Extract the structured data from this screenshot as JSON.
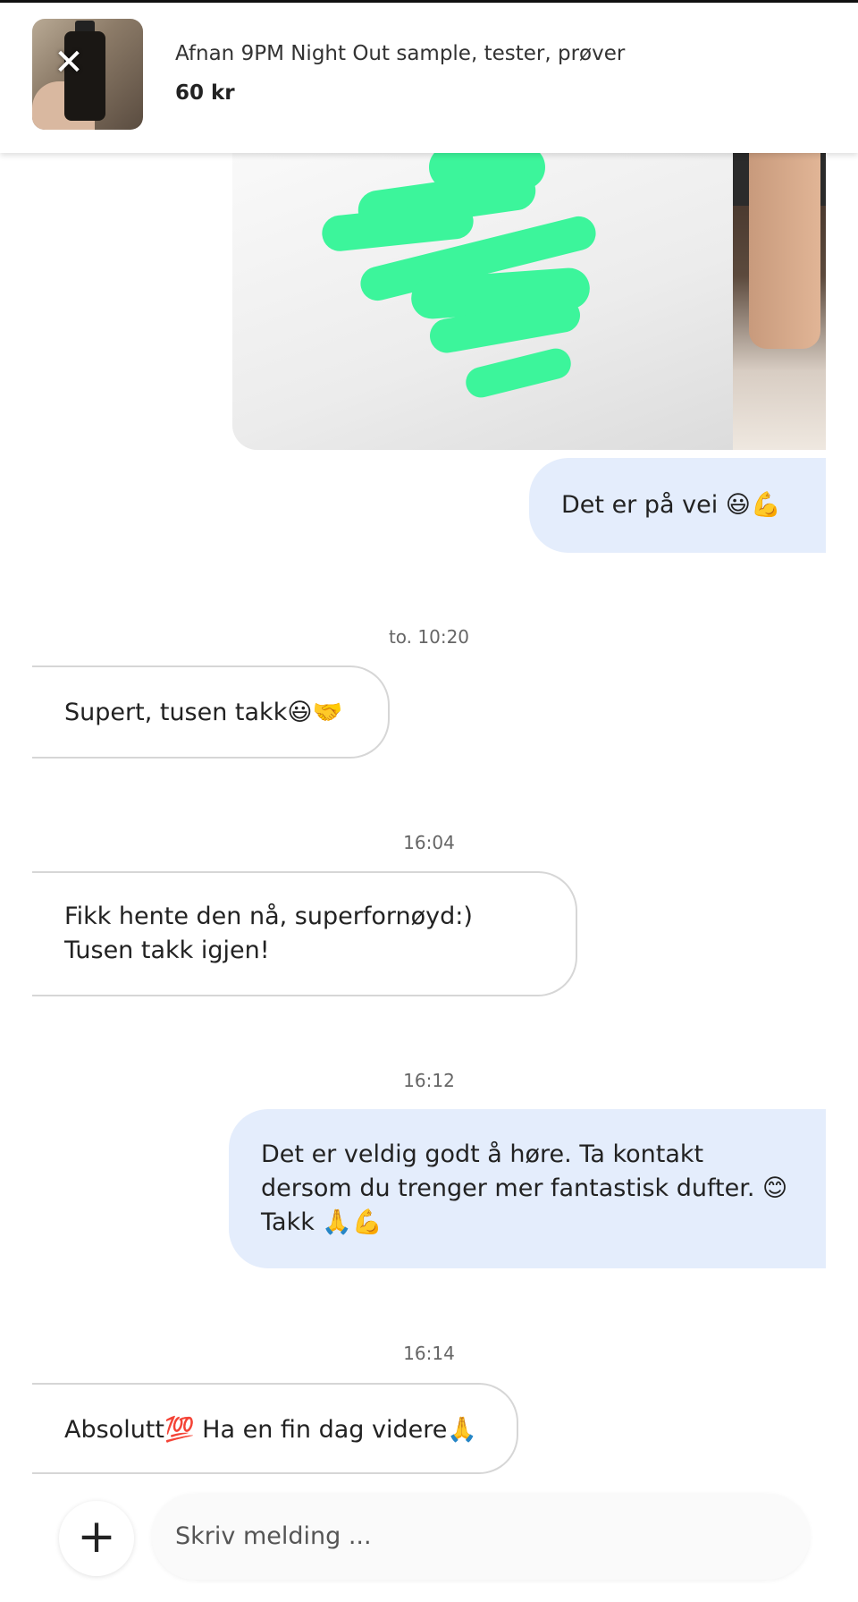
{
  "listing": {
    "title": "Afnan 9PM Night Out sample, tester, prøver",
    "price": "60 kr",
    "close_glyph": "✕"
  },
  "messages": [
    {
      "direction": "out",
      "text": "Det er på vei 😃💪"
    },
    {
      "timestamp": "to. 10:20"
    },
    {
      "direction": "in",
      "text": "Supert, tusen takk😃🤝"
    },
    {
      "timestamp": "16:04"
    },
    {
      "direction": "in",
      "text": "Fikk hente den nå, superfornøyd:) Tusen takk igjen!"
    },
    {
      "timestamp": "16:12"
    },
    {
      "direction": "out",
      "text": "Det er veldig godt å høre. Ta kontakt dersom du trenger mer fantastisk dufter. 😊 Takk 🙏💪"
    },
    {
      "timestamp": "16:14"
    },
    {
      "direction": "in",
      "text": "Absolutt💯 Ha en fin dag videre🙏"
    }
  ],
  "composer": {
    "add_glyph": "+",
    "placeholder": "Skriv melding ..."
  },
  "colors": {
    "outgoing_bubble": "#e4edfc",
    "incoming_border": "#d6d6d6",
    "redaction": "#3cf59b"
  }
}
